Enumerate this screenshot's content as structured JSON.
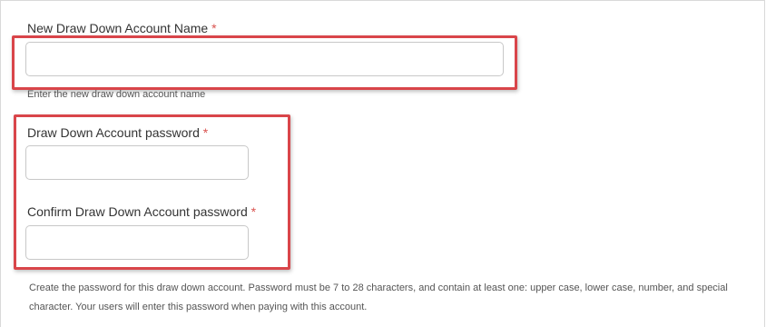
{
  "account_name": {
    "label": "New Draw Down Account Name",
    "required_mark": "*",
    "value": "",
    "hint": "Enter the new draw down account name"
  },
  "password": {
    "label": "Draw Down Account password",
    "required_mark": "*",
    "value": ""
  },
  "confirm_password": {
    "label": "Confirm Draw Down Account password",
    "required_mark": "*",
    "value": ""
  },
  "password_help": "Create the password for this draw down account. Password must be 7 to 28 characters, and contain at least one: upper case, lower case, number, and special character. Your users will enter this password when paying with this account.",
  "colors": {
    "highlight": "#d9454a",
    "required": "#d9534f"
  }
}
